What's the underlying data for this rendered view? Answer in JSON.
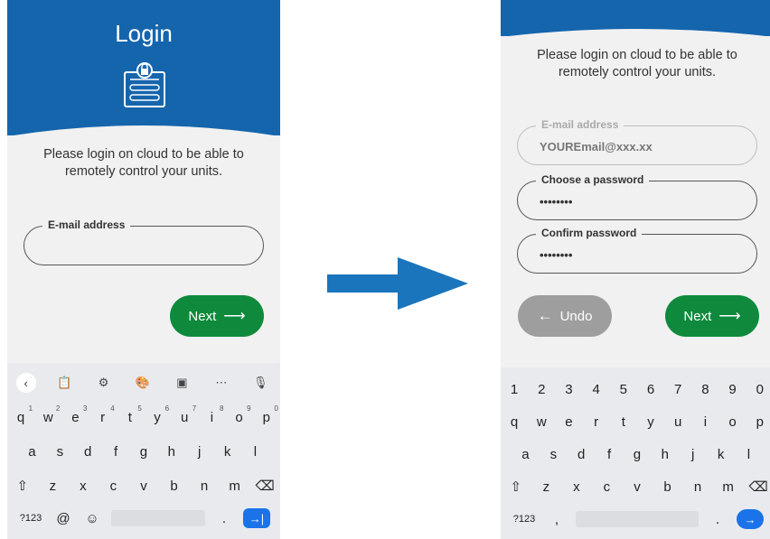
{
  "left_screen": {
    "title": "Login",
    "intro_line1": "Please login on cloud to be able to",
    "intro_line2": "remotely control your units.",
    "email_label": "E-mail address",
    "next_label": "Next",
    "next_arrow": "⟶",
    "keyboard": {
      "toolbar": [
        "<",
        "clipboard-icon",
        "gear-icon",
        "palette-icon",
        "sticker-icon",
        "…",
        "mic-off-icon"
      ],
      "row1": [
        "q",
        "w",
        "e",
        "r",
        "t",
        "y",
        "u",
        "i",
        "o",
        "p"
      ],
      "row1_hints": [
        "1",
        "2",
        "3",
        "4",
        "5",
        "6",
        "7",
        "8",
        "9",
        "0"
      ],
      "row2": [
        "a",
        "s",
        "d",
        "f",
        "g",
        "h",
        "j",
        "k",
        "l"
      ],
      "row3": [
        "z",
        "x",
        "c",
        "v",
        "b",
        "n",
        "m"
      ],
      "symbols_key": "?123",
      "at_key": "@",
      "period_key": ".",
      "enter_key": "→|"
    }
  },
  "right_screen": {
    "intro_line1": "Please login on cloud to be able to",
    "intro_line2": "remotely control your units.",
    "email_label": "E-mail address",
    "email_value": "YOUREmail@xxx.xx",
    "password_label": "Choose a password",
    "password_value": "••••••••",
    "confirm_label": "Confirm password",
    "confirm_value": "••••••••",
    "undo_label": "Undo",
    "undo_arrow": "←",
    "next_label": "Next",
    "next_arrow": "⟶",
    "keyboard": {
      "numbers": [
        "1",
        "2",
        "3",
        "4",
        "5",
        "6",
        "7",
        "8",
        "9",
        "0"
      ],
      "row1": [
        "q",
        "w",
        "e",
        "r",
        "t",
        "y",
        "u",
        "i",
        "o",
        "p"
      ],
      "row2": [
        "a",
        "s",
        "d",
        "f",
        "g",
        "h",
        "j",
        "k",
        "l"
      ],
      "row3": [
        "z",
        "x",
        "c",
        "v",
        "b",
        "n",
        "m"
      ],
      "symbols_key": "?123",
      "comma_key": ",",
      "period_key": ".",
      "enter_key": "→"
    }
  },
  "colors": {
    "header_blue": "#1565ad",
    "arrow_blue": "#1b75bc",
    "next_green": "#0f8a3d",
    "undo_gray": "#9e9e9e"
  }
}
